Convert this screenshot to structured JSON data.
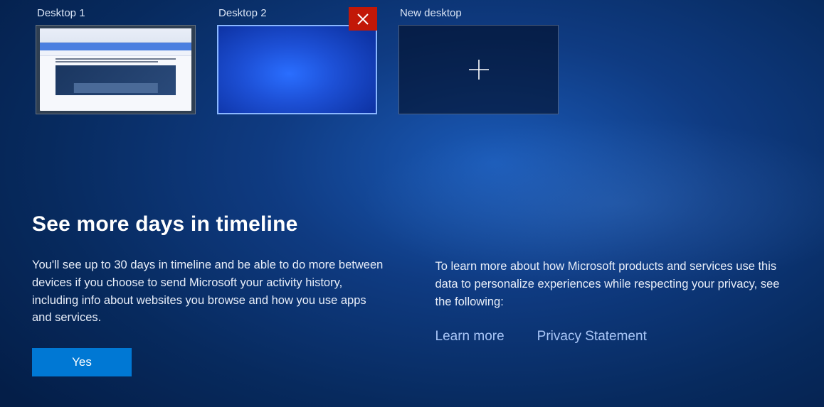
{
  "desktops": {
    "items": [
      {
        "label": "Desktop 1",
        "selected": false
      },
      {
        "label": "Desktop 2",
        "selected": true
      }
    ],
    "new_label": "New desktop"
  },
  "icons": {
    "close": "close-icon",
    "plus": "plus-icon"
  },
  "promo": {
    "title": "See more days in timeline",
    "body_left": "You'll see up to 30 days in timeline and be able to do more between devices if you choose to send Microsoft your activity history, including info about websites you browse and how you use apps and services.",
    "body_right": "To learn more about how Microsoft products and services use this data to personalize experiences while respecting your privacy, see the following:",
    "yes_label": "Yes",
    "learn_more": "Learn more",
    "privacy": "Privacy Statement"
  }
}
